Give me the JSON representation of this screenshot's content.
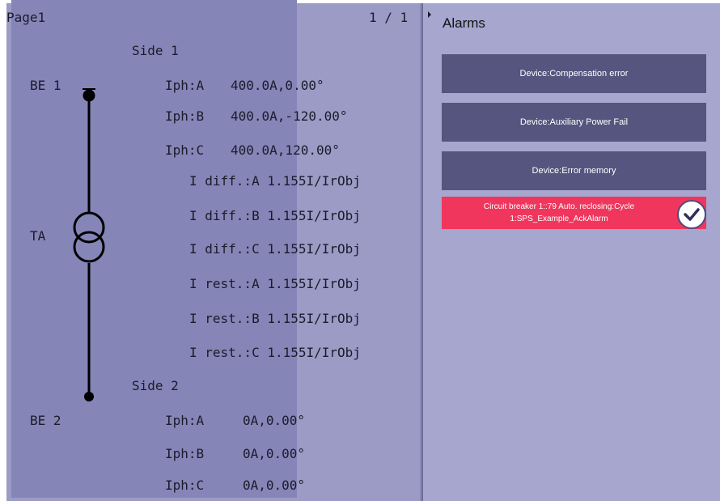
{
  "page": {
    "title": "Page1",
    "page_indicator": "1 / 1"
  },
  "single_line": {
    "labels": {
      "be1": "BE 1",
      "ta": "TA",
      "be2": "BE 2"
    },
    "side1": {
      "title": "Side 1",
      "rows": [
        {
          "label": "Iph:A",
          "value": "400.0A,0.00°"
        },
        {
          "label": "Iph:B",
          "value": "400.0A,-120.00°"
        },
        {
          "label": "Iph:C",
          "value": "400.0A,120.00°"
        }
      ]
    },
    "measurements": [
      "I diff.:A 1.155I/IrObj",
      "I diff.:B 1.155I/IrObj",
      "I diff.:C 1.155I/IrObj",
      "I rest.:A 1.155I/IrObj",
      "I rest.:B 1.155I/IrObj",
      "I rest.:C 1.155I/IrObj"
    ],
    "side2": {
      "title": "Side 2",
      "rows": [
        {
          "label": "Iph:A",
          "value": "0A,0.00°"
        },
        {
          "label": "Iph:B",
          "value": "0A,0.00°"
        },
        {
          "label": "Iph:C",
          "value": "0A,0.00°"
        }
      ]
    }
  },
  "alarms": {
    "title": "Alarms",
    "items": [
      {
        "text": "Device:Compensation error"
      },
      {
        "text": "Device:Auxiliary Power Fail"
      },
      {
        "text": "Device:Error memory"
      }
    ],
    "active": {
      "line1": "Circuit breaker 1::79 Auto. reclosing:Cycle",
      "line2": "1:SPS_Example_AckAlarm",
      "ack_icon": "check-circle-icon"
    }
  },
  "colors": {
    "left_bg": "#9b9bc6",
    "right_bg": "#8585b8",
    "alarm_button": "#55557f",
    "alarm_active": "#f0365c"
  }
}
